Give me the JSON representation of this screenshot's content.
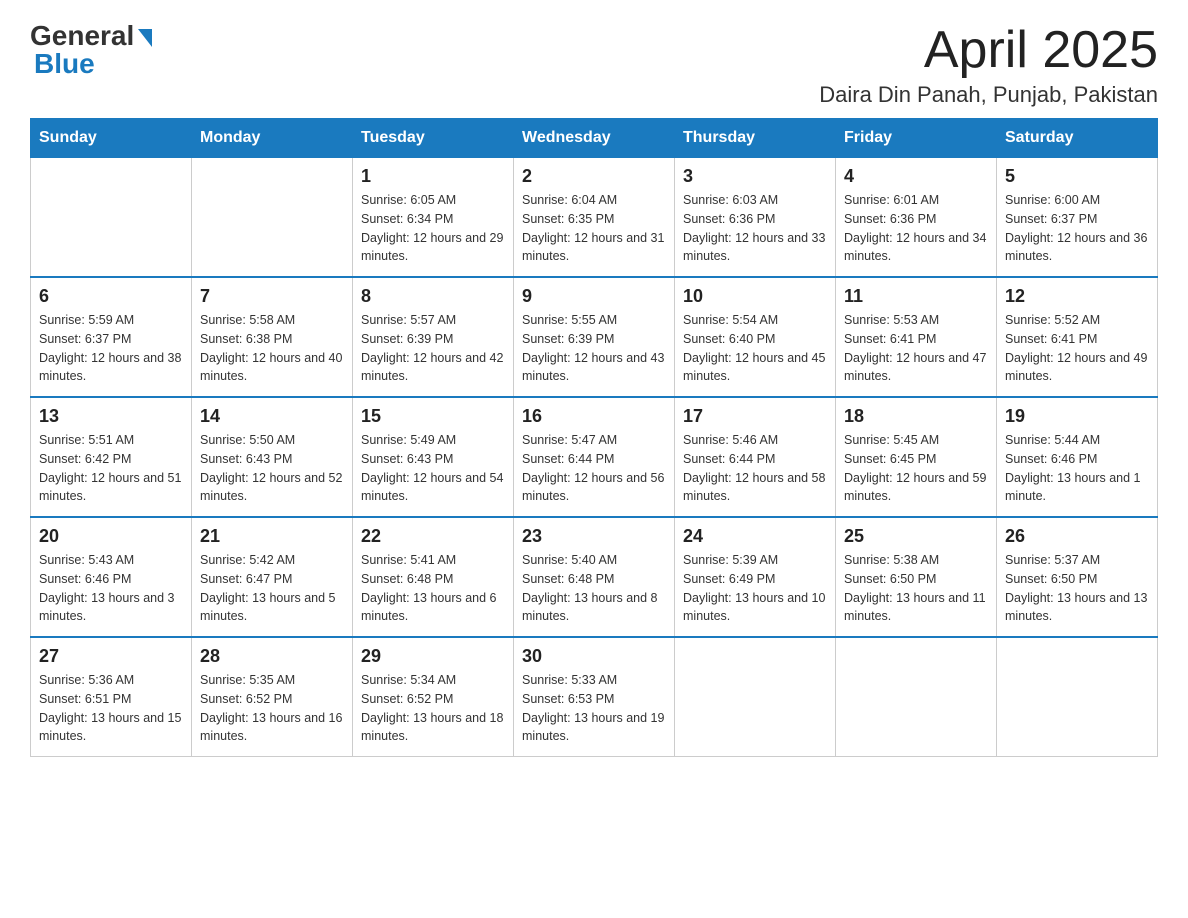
{
  "header": {
    "logo_general": "General",
    "logo_blue": "Blue",
    "title": "April 2025",
    "subtitle": "Daira Din Panah, Punjab, Pakistan"
  },
  "weekdays": [
    "Sunday",
    "Monday",
    "Tuesday",
    "Wednesday",
    "Thursday",
    "Friday",
    "Saturday"
  ],
  "weeks": [
    [
      {
        "day": "",
        "sunrise": "",
        "sunset": "",
        "daylight": ""
      },
      {
        "day": "",
        "sunrise": "",
        "sunset": "",
        "daylight": ""
      },
      {
        "day": "1",
        "sunrise": "Sunrise: 6:05 AM",
        "sunset": "Sunset: 6:34 PM",
        "daylight": "Daylight: 12 hours and 29 minutes."
      },
      {
        "day": "2",
        "sunrise": "Sunrise: 6:04 AM",
        "sunset": "Sunset: 6:35 PM",
        "daylight": "Daylight: 12 hours and 31 minutes."
      },
      {
        "day": "3",
        "sunrise": "Sunrise: 6:03 AM",
        "sunset": "Sunset: 6:36 PM",
        "daylight": "Daylight: 12 hours and 33 minutes."
      },
      {
        "day": "4",
        "sunrise": "Sunrise: 6:01 AM",
        "sunset": "Sunset: 6:36 PM",
        "daylight": "Daylight: 12 hours and 34 minutes."
      },
      {
        "day": "5",
        "sunrise": "Sunrise: 6:00 AM",
        "sunset": "Sunset: 6:37 PM",
        "daylight": "Daylight: 12 hours and 36 minutes."
      }
    ],
    [
      {
        "day": "6",
        "sunrise": "Sunrise: 5:59 AM",
        "sunset": "Sunset: 6:37 PM",
        "daylight": "Daylight: 12 hours and 38 minutes."
      },
      {
        "day": "7",
        "sunrise": "Sunrise: 5:58 AM",
        "sunset": "Sunset: 6:38 PM",
        "daylight": "Daylight: 12 hours and 40 minutes."
      },
      {
        "day": "8",
        "sunrise": "Sunrise: 5:57 AM",
        "sunset": "Sunset: 6:39 PM",
        "daylight": "Daylight: 12 hours and 42 minutes."
      },
      {
        "day": "9",
        "sunrise": "Sunrise: 5:55 AM",
        "sunset": "Sunset: 6:39 PM",
        "daylight": "Daylight: 12 hours and 43 minutes."
      },
      {
        "day": "10",
        "sunrise": "Sunrise: 5:54 AM",
        "sunset": "Sunset: 6:40 PM",
        "daylight": "Daylight: 12 hours and 45 minutes."
      },
      {
        "day": "11",
        "sunrise": "Sunrise: 5:53 AM",
        "sunset": "Sunset: 6:41 PM",
        "daylight": "Daylight: 12 hours and 47 minutes."
      },
      {
        "day": "12",
        "sunrise": "Sunrise: 5:52 AM",
        "sunset": "Sunset: 6:41 PM",
        "daylight": "Daylight: 12 hours and 49 minutes."
      }
    ],
    [
      {
        "day": "13",
        "sunrise": "Sunrise: 5:51 AM",
        "sunset": "Sunset: 6:42 PM",
        "daylight": "Daylight: 12 hours and 51 minutes."
      },
      {
        "day": "14",
        "sunrise": "Sunrise: 5:50 AM",
        "sunset": "Sunset: 6:43 PM",
        "daylight": "Daylight: 12 hours and 52 minutes."
      },
      {
        "day": "15",
        "sunrise": "Sunrise: 5:49 AM",
        "sunset": "Sunset: 6:43 PM",
        "daylight": "Daylight: 12 hours and 54 minutes."
      },
      {
        "day": "16",
        "sunrise": "Sunrise: 5:47 AM",
        "sunset": "Sunset: 6:44 PM",
        "daylight": "Daylight: 12 hours and 56 minutes."
      },
      {
        "day": "17",
        "sunrise": "Sunrise: 5:46 AM",
        "sunset": "Sunset: 6:44 PM",
        "daylight": "Daylight: 12 hours and 58 minutes."
      },
      {
        "day": "18",
        "sunrise": "Sunrise: 5:45 AM",
        "sunset": "Sunset: 6:45 PM",
        "daylight": "Daylight: 12 hours and 59 minutes."
      },
      {
        "day": "19",
        "sunrise": "Sunrise: 5:44 AM",
        "sunset": "Sunset: 6:46 PM",
        "daylight": "Daylight: 13 hours and 1 minute."
      }
    ],
    [
      {
        "day": "20",
        "sunrise": "Sunrise: 5:43 AM",
        "sunset": "Sunset: 6:46 PM",
        "daylight": "Daylight: 13 hours and 3 minutes."
      },
      {
        "day": "21",
        "sunrise": "Sunrise: 5:42 AM",
        "sunset": "Sunset: 6:47 PM",
        "daylight": "Daylight: 13 hours and 5 minutes."
      },
      {
        "day": "22",
        "sunrise": "Sunrise: 5:41 AM",
        "sunset": "Sunset: 6:48 PM",
        "daylight": "Daylight: 13 hours and 6 minutes."
      },
      {
        "day": "23",
        "sunrise": "Sunrise: 5:40 AM",
        "sunset": "Sunset: 6:48 PM",
        "daylight": "Daylight: 13 hours and 8 minutes."
      },
      {
        "day": "24",
        "sunrise": "Sunrise: 5:39 AM",
        "sunset": "Sunset: 6:49 PM",
        "daylight": "Daylight: 13 hours and 10 minutes."
      },
      {
        "day": "25",
        "sunrise": "Sunrise: 5:38 AM",
        "sunset": "Sunset: 6:50 PM",
        "daylight": "Daylight: 13 hours and 11 minutes."
      },
      {
        "day": "26",
        "sunrise": "Sunrise: 5:37 AM",
        "sunset": "Sunset: 6:50 PM",
        "daylight": "Daylight: 13 hours and 13 minutes."
      }
    ],
    [
      {
        "day": "27",
        "sunrise": "Sunrise: 5:36 AM",
        "sunset": "Sunset: 6:51 PM",
        "daylight": "Daylight: 13 hours and 15 minutes."
      },
      {
        "day": "28",
        "sunrise": "Sunrise: 5:35 AM",
        "sunset": "Sunset: 6:52 PM",
        "daylight": "Daylight: 13 hours and 16 minutes."
      },
      {
        "day": "29",
        "sunrise": "Sunrise: 5:34 AM",
        "sunset": "Sunset: 6:52 PM",
        "daylight": "Daylight: 13 hours and 18 minutes."
      },
      {
        "day": "30",
        "sunrise": "Sunrise: 5:33 AM",
        "sunset": "Sunset: 6:53 PM",
        "daylight": "Daylight: 13 hours and 19 minutes."
      },
      {
        "day": "",
        "sunrise": "",
        "sunset": "",
        "daylight": ""
      },
      {
        "day": "",
        "sunrise": "",
        "sunset": "",
        "daylight": ""
      },
      {
        "day": "",
        "sunrise": "",
        "sunset": "",
        "daylight": ""
      }
    ]
  ]
}
